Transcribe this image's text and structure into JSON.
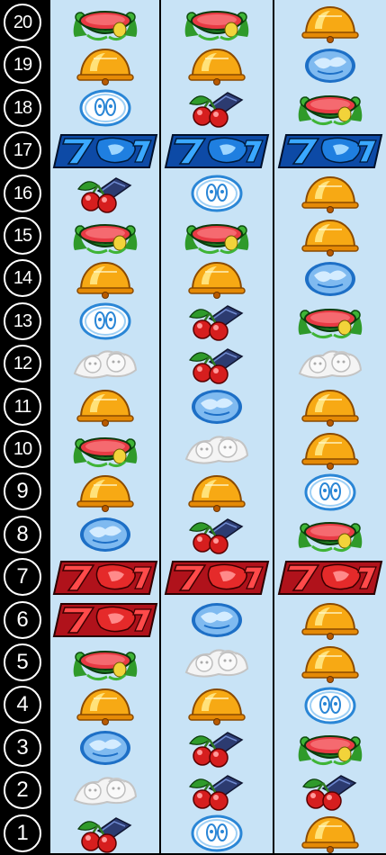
{
  "rows": [
    "20",
    "19",
    "18",
    "17",
    "16",
    "15",
    "14",
    "13",
    "12",
    "11",
    "10",
    "9",
    "8",
    "7",
    "6",
    "5",
    "4",
    "3",
    "2",
    "1"
  ],
  "reels": [
    {
      "symbols": [
        "watermelon",
        "bell",
        "replay",
        "blue7",
        "cherry",
        "watermelon",
        "bell",
        "replay",
        "character",
        "bell",
        "watermelon",
        "bell",
        "plum",
        "red7",
        "red7",
        "watermelon",
        "bell",
        "plum",
        "character",
        "cherry"
      ]
    },
    {
      "symbols": [
        "watermelon",
        "bell",
        "cherry",
        "blue7",
        "replay",
        "watermelon",
        "bell",
        "cherry",
        "cherry",
        "plum",
        "character",
        "bell",
        "cherry",
        "red7",
        "plum",
        "character",
        "bell",
        "cherry",
        "cherry",
        "replay"
      ]
    },
    {
      "symbols": [
        "bell",
        "plum",
        "watermelon",
        "blue7",
        "bell",
        "bell",
        "plum",
        "watermelon",
        "character",
        "bell",
        "bell",
        "replay",
        "watermelon",
        "red7",
        "bell",
        "bell",
        "replay",
        "watermelon",
        "cherry",
        "bell"
      ]
    }
  ]
}
